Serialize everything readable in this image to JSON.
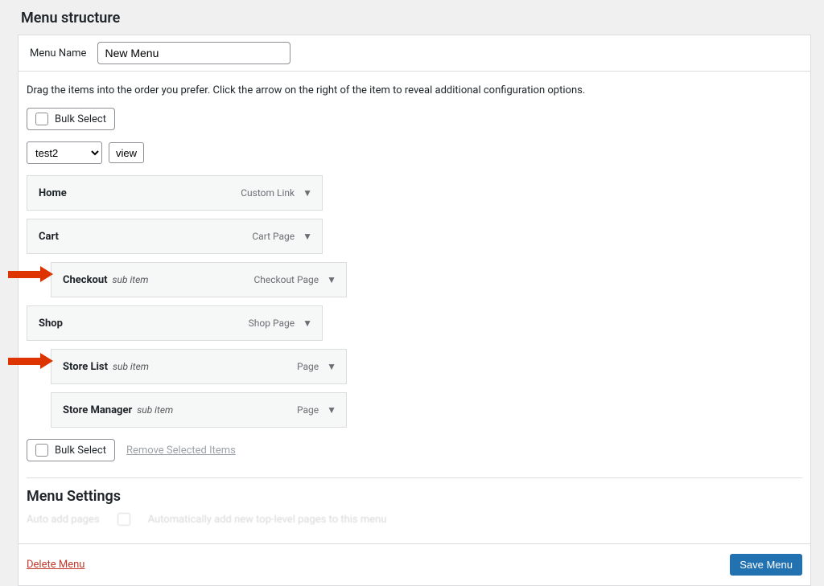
{
  "title": "Menu structure",
  "menu_name_label": "Menu Name",
  "menu_name_value": "New Menu",
  "hint": "Drag the items into the order you prefer. Click the arrow on the right of the item to reveal additional configuration options.",
  "bulk_select_label": "Bulk Select",
  "group_select_value": "test2",
  "view_label": "view",
  "items": [
    {
      "title": "Home",
      "type": "Custom Link",
      "sub": false,
      "indent": false,
      "arrow": false
    },
    {
      "title": "Cart",
      "type": "Cart Page",
      "sub": false,
      "indent": false,
      "arrow": false
    },
    {
      "title": "Checkout",
      "type": "Checkout Page",
      "sub": true,
      "indent": true,
      "arrow": true
    },
    {
      "title": "Shop",
      "type": "Shop Page",
      "sub": false,
      "indent": false,
      "arrow": false
    },
    {
      "title": "Store List",
      "type": "Page",
      "sub": true,
      "indent": true,
      "arrow": true
    },
    {
      "title": "Store Manager",
      "type": "Page",
      "sub": true,
      "indent": true,
      "arrow": false
    }
  ],
  "sub_item_text": "sub item",
  "remove_selected_label": "Remove Selected Items",
  "menu_settings_title": "Menu Settings",
  "auto_add_label": "Auto add pages",
  "auto_add_desc": "Automatically add new top-level pages to this menu",
  "delete_label": "Delete Menu",
  "save_label": "Save Menu"
}
